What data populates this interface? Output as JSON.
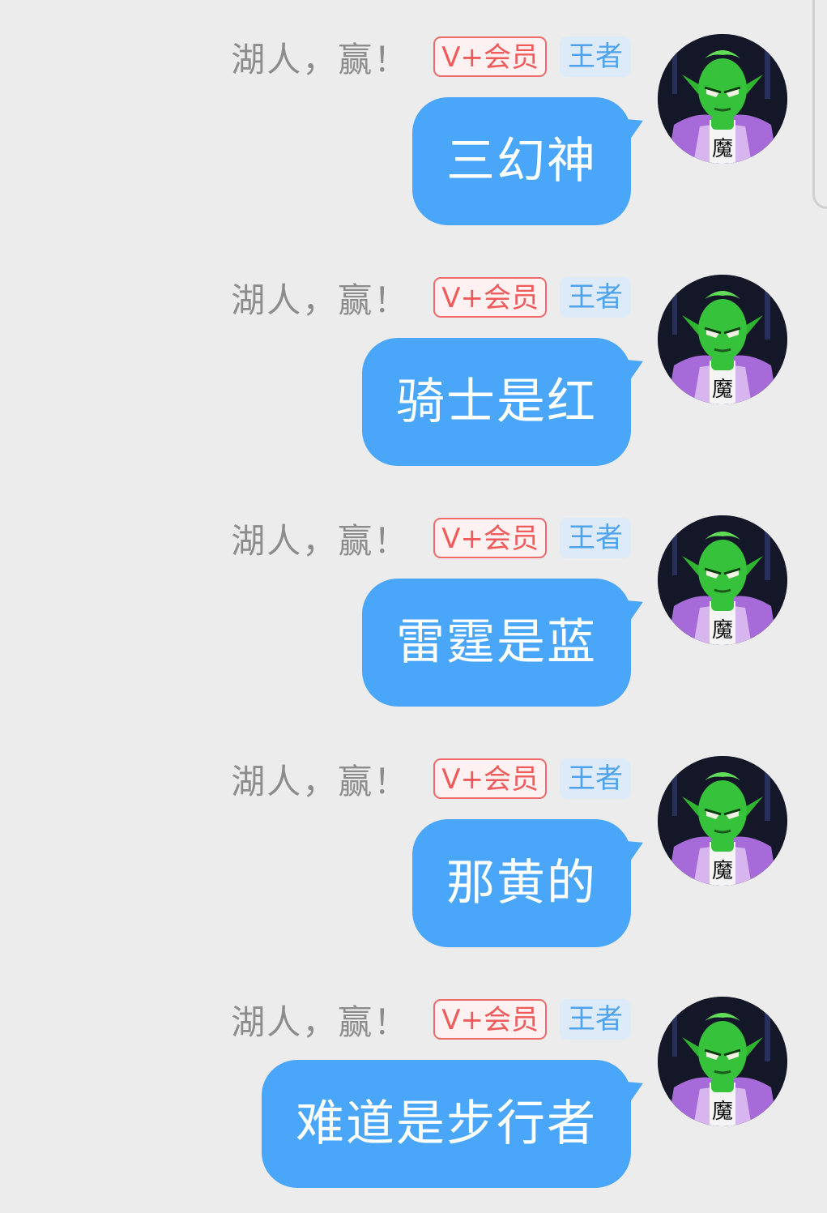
{
  "messages": [
    {
      "sender": "湖人，赢！",
      "vip_badge": "V+会员",
      "rank_badge": "王者",
      "text": "三幻神"
    },
    {
      "sender": "湖人，赢！",
      "vip_badge": "V+会员",
      "rank_badge": "王者",
      "text": "骑士是红"
    },
    {
      "sender": "湖人，赢！",
      "vip_badge": "V+会员",
      "rank_badge": "王者",
      "text": "雷霆是蓝"
    },
    {
      "sender": "湖人，赢！",
      "vip_badge": "V+会员",
      "rank_badge": "王者",
      "text": "那黄的"
    },
    {
      "sender": "湖人，赢！",
      "vip_badge": "V+会员",
      "rank_badge": "王者",
      "text": "难道是步行者"
    }
  ],
  "avatar": {
    "icon": "green-demon-character-avatar",
    "character_glyph": "魔"
  },
  "colors": {
    "background": "#ececec",
    "bubble": "#4aa6f8",
    "bubble_text": "#ffffff",
    "sender_name": "#8c8c8c",
    "vip_badge": "#ef5b5b",
    "rank_badge": "#4fa3ec"
  }
}
